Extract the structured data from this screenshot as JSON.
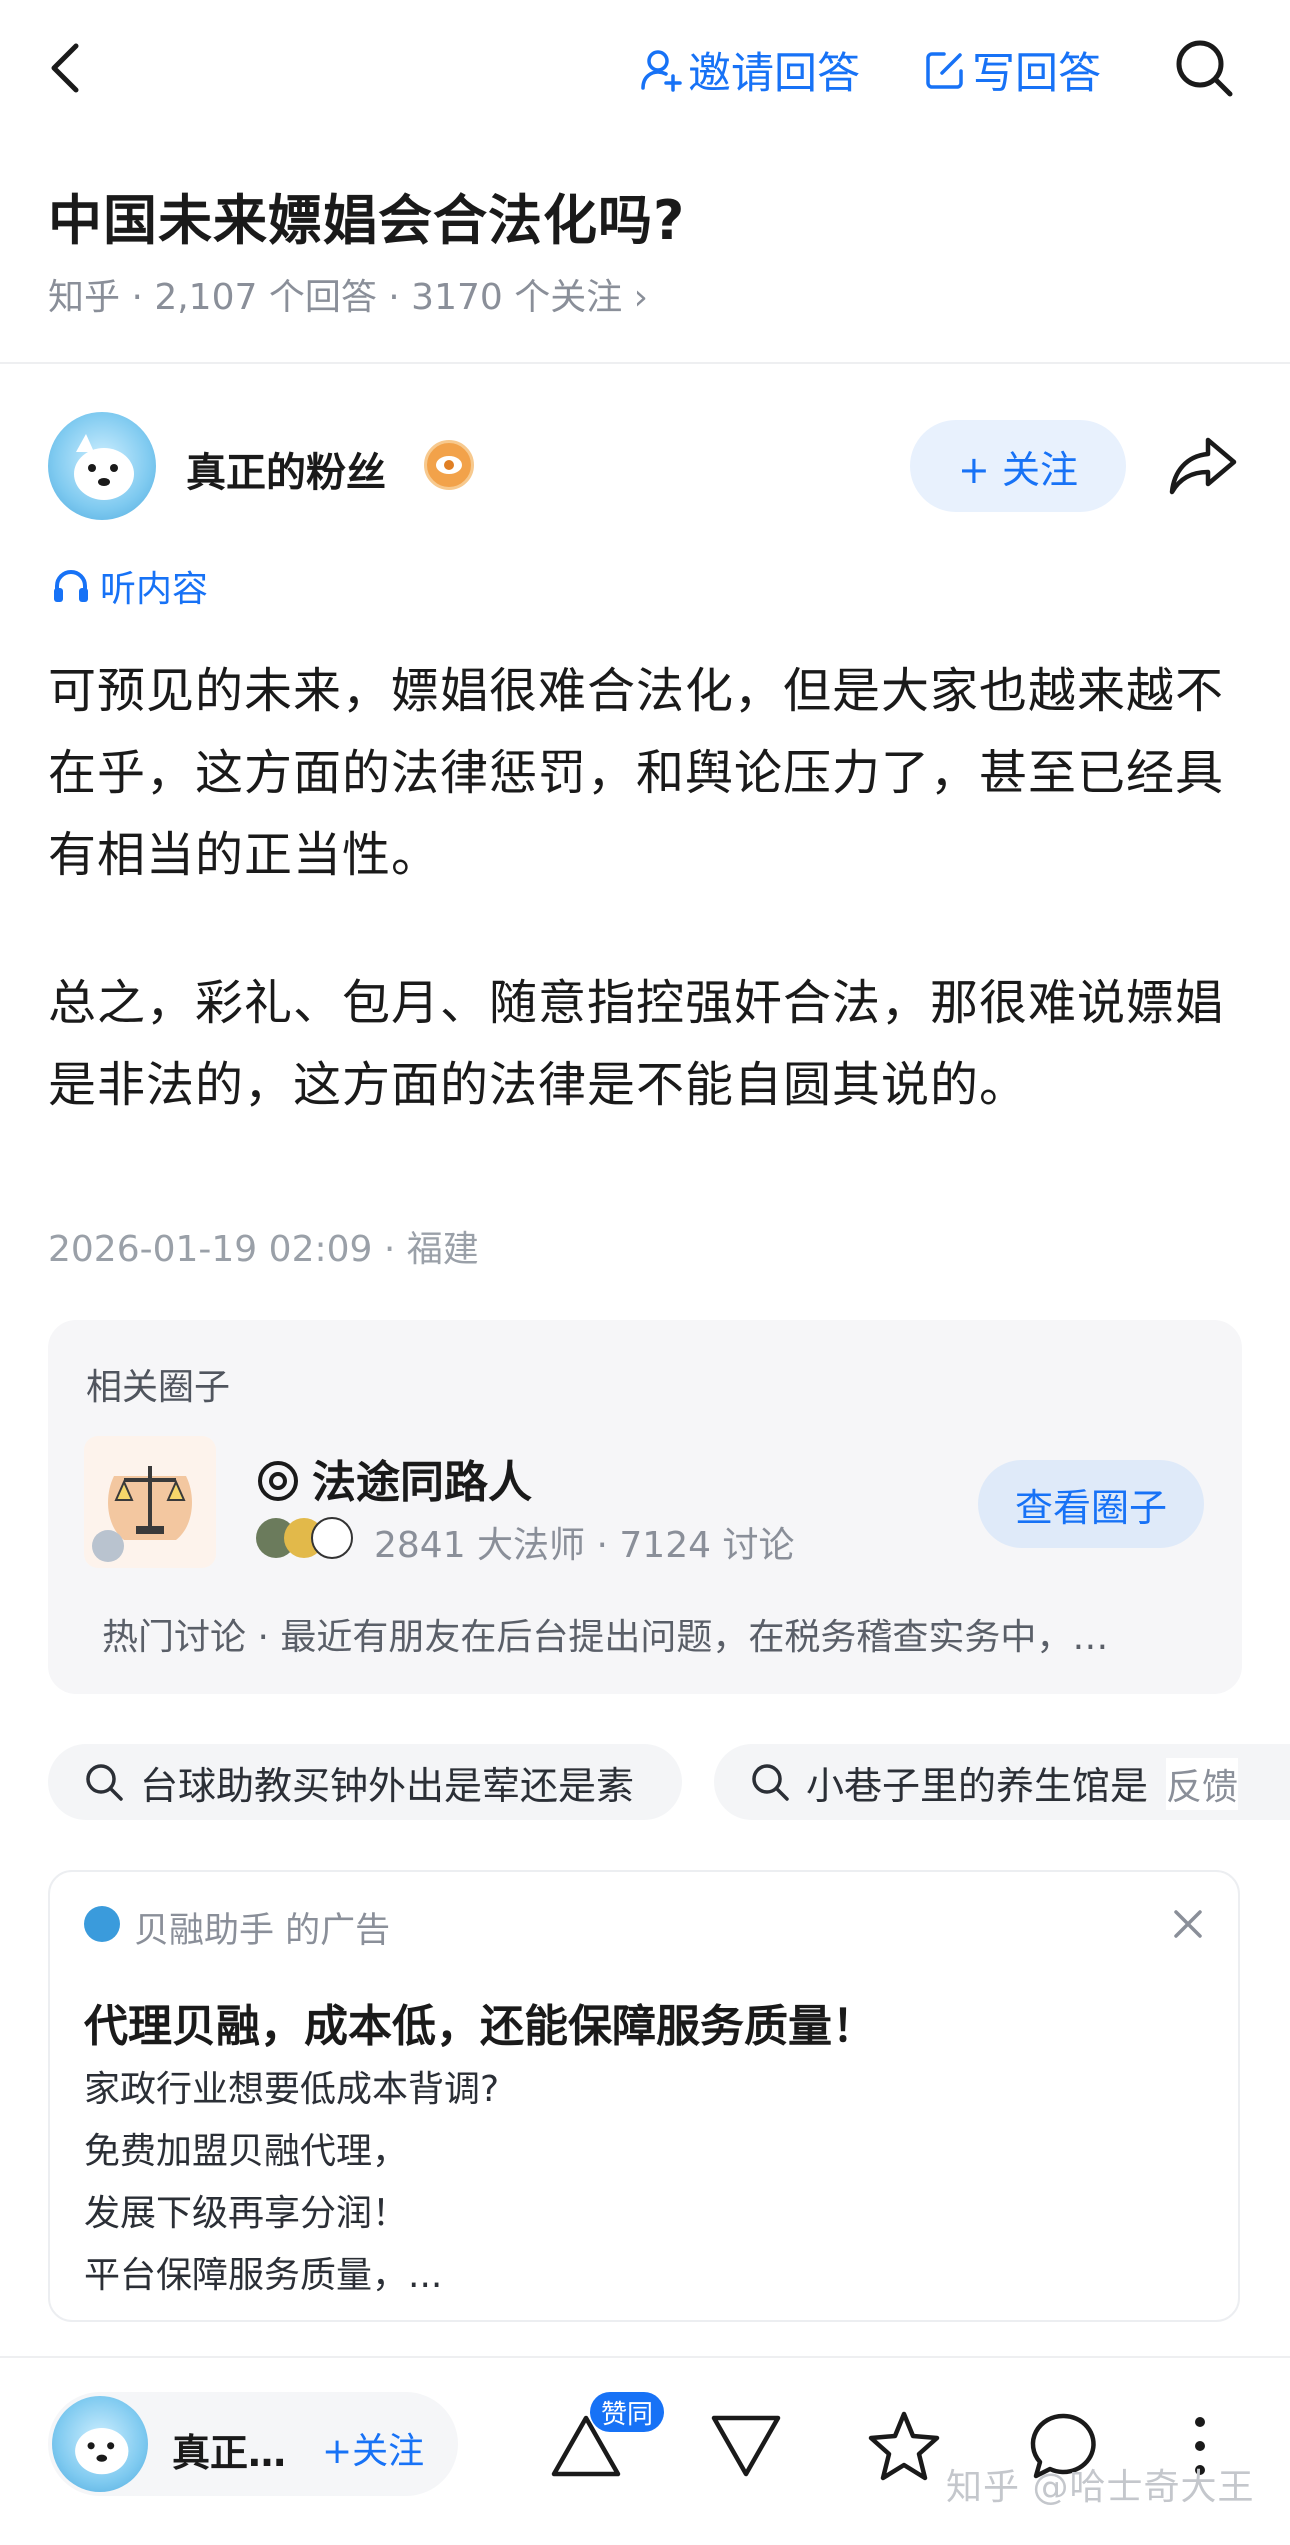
{
  "topbar": {
    "invite_label": "邀请回答",
    "write_label": "写回答"
  },
  "question": {
    "title": "中国未来嫖娼会合法化吗?",
    "meta": "知乎 · 2,107 个回答 · 3170 个关注 ›"
  },
  "author": {
    "name": "真正的粉丝",
    "follow_label": "+ 关注"
  },
  "listen_label": "听内容",
  "answer": {
    "paragraphs": [
      "可预见的未来，嫖娼很难合法化，但是大家也越来越不在乎，这方面的法律惩罚，和舆论压力了，甚至已经具有相当的正当性。",
      "总之，彩礼、包月、随意指控强奸合法，那很难说嫖娼是非法的，这方面的法律是不能自圆其说的。"
    ],
    "meta": "2026-01-19 02:09 · 福建"
  },
  "circle": {
    "section_label": "相关圈子",
    "name": "法途同路人",
    "stats": "2841 大法师 · 7124 讨论",
    "view_label": "查看圈子",
    "hot_discussion": "热门讨论 · 最近有朋友在后台提出问题，在税务稽查实务中，…"
  },
  "search_chips": [
    "台球助教买钟外出是荤还是素",
    "小巷子里的养生馆是"
  ],
  "feedback_label": "反馈",
  "ad": {
    "source": "贝融助手 的广告",
    "title": "代理贝融，成本低，还能保障服务质量！",
    "lines": [
      "家政行业想要低成本背调?",
      "免费加盟贝融代理，",
      "发展下级再享分润！",
      "平台保障服务质量，..."
    ]
  },
  "bottom": {
    "author_short": "真正…",
    "follow_label": "+关注",
    "upvote_badge": "赞同",
    "watermark": "知乎 @哈士奇大王"
  },
  "colors": {
    "accent": "#1772f6",
    "muted": "#8a8f99",
    "card_bg": "#f6f6f8"
  }
}
